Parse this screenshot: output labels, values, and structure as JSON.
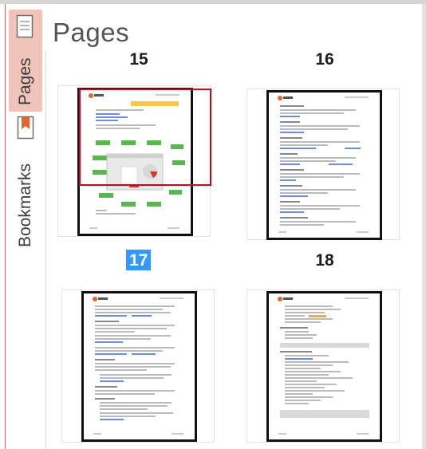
{
  "panel": {
    "title": "Pages",
    "tabs": [
      {
        "label": "Pages",
        "icon": "page-icon",
        "active": true
      },
      {
        "label": "Bookmarks",
        "icon": "bookmark-icon",
        "active": false
      }
    ]
  },
  "thumbnails": [
    {
      "page": "15",
      "selected": false,
      "content": "diagram-with-highlight"
    },
    {
      "page": "16",
      "selected": false,
      "content": "text"
    },
    {
      "page": "17",
      "selected": true,
      "content": "text"
    },
    {
      "page": "18",
      "selected": false,
      "content": "text-with-boxes"
    }
  ],
  "colors": {
    "selection": "#3399ff",
    "active_tab": "#f2c4b9",
    "bookmark_icon": "#e8642b",
    "highlight_rect": "#d0021b"
  }
}
